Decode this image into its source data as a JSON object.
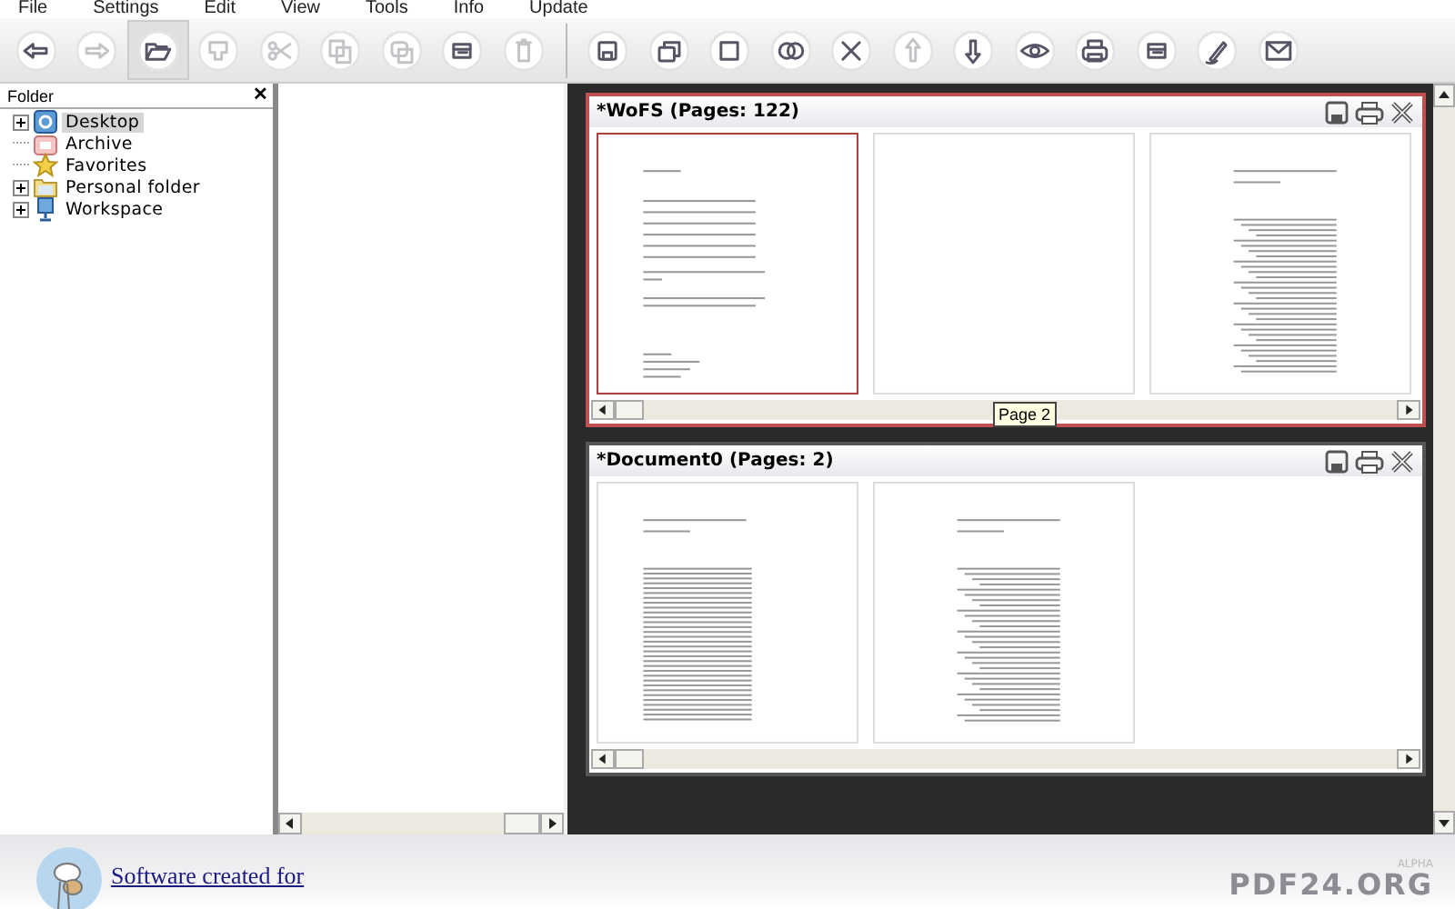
{
  "menu": [
    "File",
    "Settings",
    "Edit",
    "View",
    "Tools",
    "Info",
    "Update"
  ],
  "toolbar": [
    [
      {
        "kind": "back",
        "disabled": false,
        "selected": false
      },
      {
        "kind": "forward",
        "disabled": true,
        "selected": false
      },
      {
        "kind": "open",
        "disabled": false,
        "selected": true
      },
      {
        "kind": "import",
        "disabled": true,
        "selected": false
      },
      {
        "kind": "cut",
        "disabled": true,
        "selected": false
      },
      {
        "kind": "copy",
        "disabled": true,
        "selected": false
      },
      {
        "kind": "paste",
        "disabled": true,
        "selected": false
      },
      {
        "kind": "grid",
        "disabled": false,
        "selected": false
      },
      {
        "kind": "trash",
        "disabled": true,
        "selected": false
      }
    ],
    [
      {
        "kind": "save",
        "disabled": false,
        "selected": false
      },
      {
        "kind": "save-all",
        "disabled": false,
        "selected": false
      },
      {
        "kind": "square",
        "disabled": false,
        "selected": false
      },
      {
        "kind": "join",
        "disabled": false,
        "selected": false
      },
      {
        "kind": "delete",
        "disabled": false,
        "selected": false
      },
      {
        "kind": "up",
        "disabled": true,
        "selected": false
      },
      {
        "kind": "down",
        "disabled": false,
        "selected": false
      },
      {
        "kind": "eye",
        "disabled": false,
        "selected": false
      },
      {
        "kind": "print",
        "disabled": false,
        "selected": false
      },
      {
        "kind": "grid",
        "disabled": false,
        "selected": false
      },
      {
        "kind": "pen",
        "disabled": false,
        "selected": false
      },
      {
        "kind": "mail",
        "disabled": false,
        "selected": false
      }
    ]
  ],
  "folder_panel": {
    "title": "Folder",
    "close": "✕",
    "items": [
      {
        "label": "Desktop",
        "kind": "desktop",
        "expandable": true,
        "selected": true
      },
      {
        "label": "Archive",
        "kind": "archive",
        "expandable": false,
        "selected": false
      },
      {
        "label": "Favorites",
        "kind": "star",
        "expandable": false,
        "selected": false
      },
      {
        "label": "Personal folder",
        "kind": "folder",
        "expandable": true,
        "selected": false
      },
      {
        "label": "Workspace",
        "kind": "computer",
        "expandable": true,
        "selected": false
      }
    ]
  },
  "documents": [
    {
      "title": "*WoFS (Pages: 122)",
      "selected": true,
      "tooltip": "Page 2",
      "pages": [
        {
          "kind": "title",
          "selected": true
        },
        {
          "kind": "blank",
          "selected": false
        },
        {
          "kind": "toc",
          "selected": false
        }
      ]
    },
    {
      "title": "*Document0 (Pages: 2)",
      "selected": false,
      "pages": [
        {
          "kind": "text",
          "selected": false
        },
        {
          "kind": "toc",
          "selected": false
        }
      ]
    }
  ],
  "footer": {
    "link": "Software created for",
    "badge": "ALPHA",
    "brand": "PDF24.ORG"
  }
}
